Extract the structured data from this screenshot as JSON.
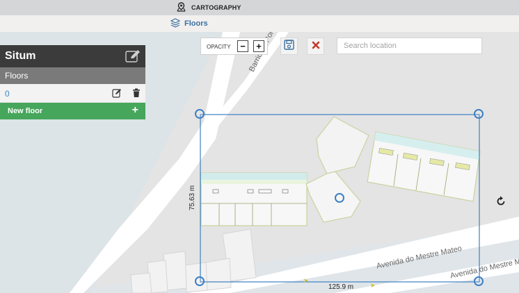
{
  "app": {
    "title": "CARTOGRAPHY",
    "title_icon": "map-pin-icon"
  },
  "tab": {
    "label": "Floors",
    "icon": "layers-icon"
  },
  "panel": {
    "building_name": "Situm",
    "section_label": "Floors",
    "floors": [
      {
        "name": "0"
      }
    ],
    "new_floor_label": "New floor",
    "new_floor_icon": "plus"
  },
  "toolbar": {
    "opacity_label": "OPACITY",
    "minus": "−",
    "plus": "+",
    "save_icon": "save-icon",
    "cancel_icon": "close-icon"
  },
  "search": {
    "placeholder": "Search location",
    "value": ""
  },
  "map": {
    "streets": [
      "Barrio da Pon",
      "Avenida do Mestre Mateo",
      "Avenida do Mestre M"
    ],
    "width_label": "125.9 m",
    "height_label": "75.63 m"
  },
  "colors": {
    "accent": "#3a6f9e",
    "handle": "#3d7fc2",
    "green": "#46a65c",
    "cancel": "#c0392b"
  }
}
